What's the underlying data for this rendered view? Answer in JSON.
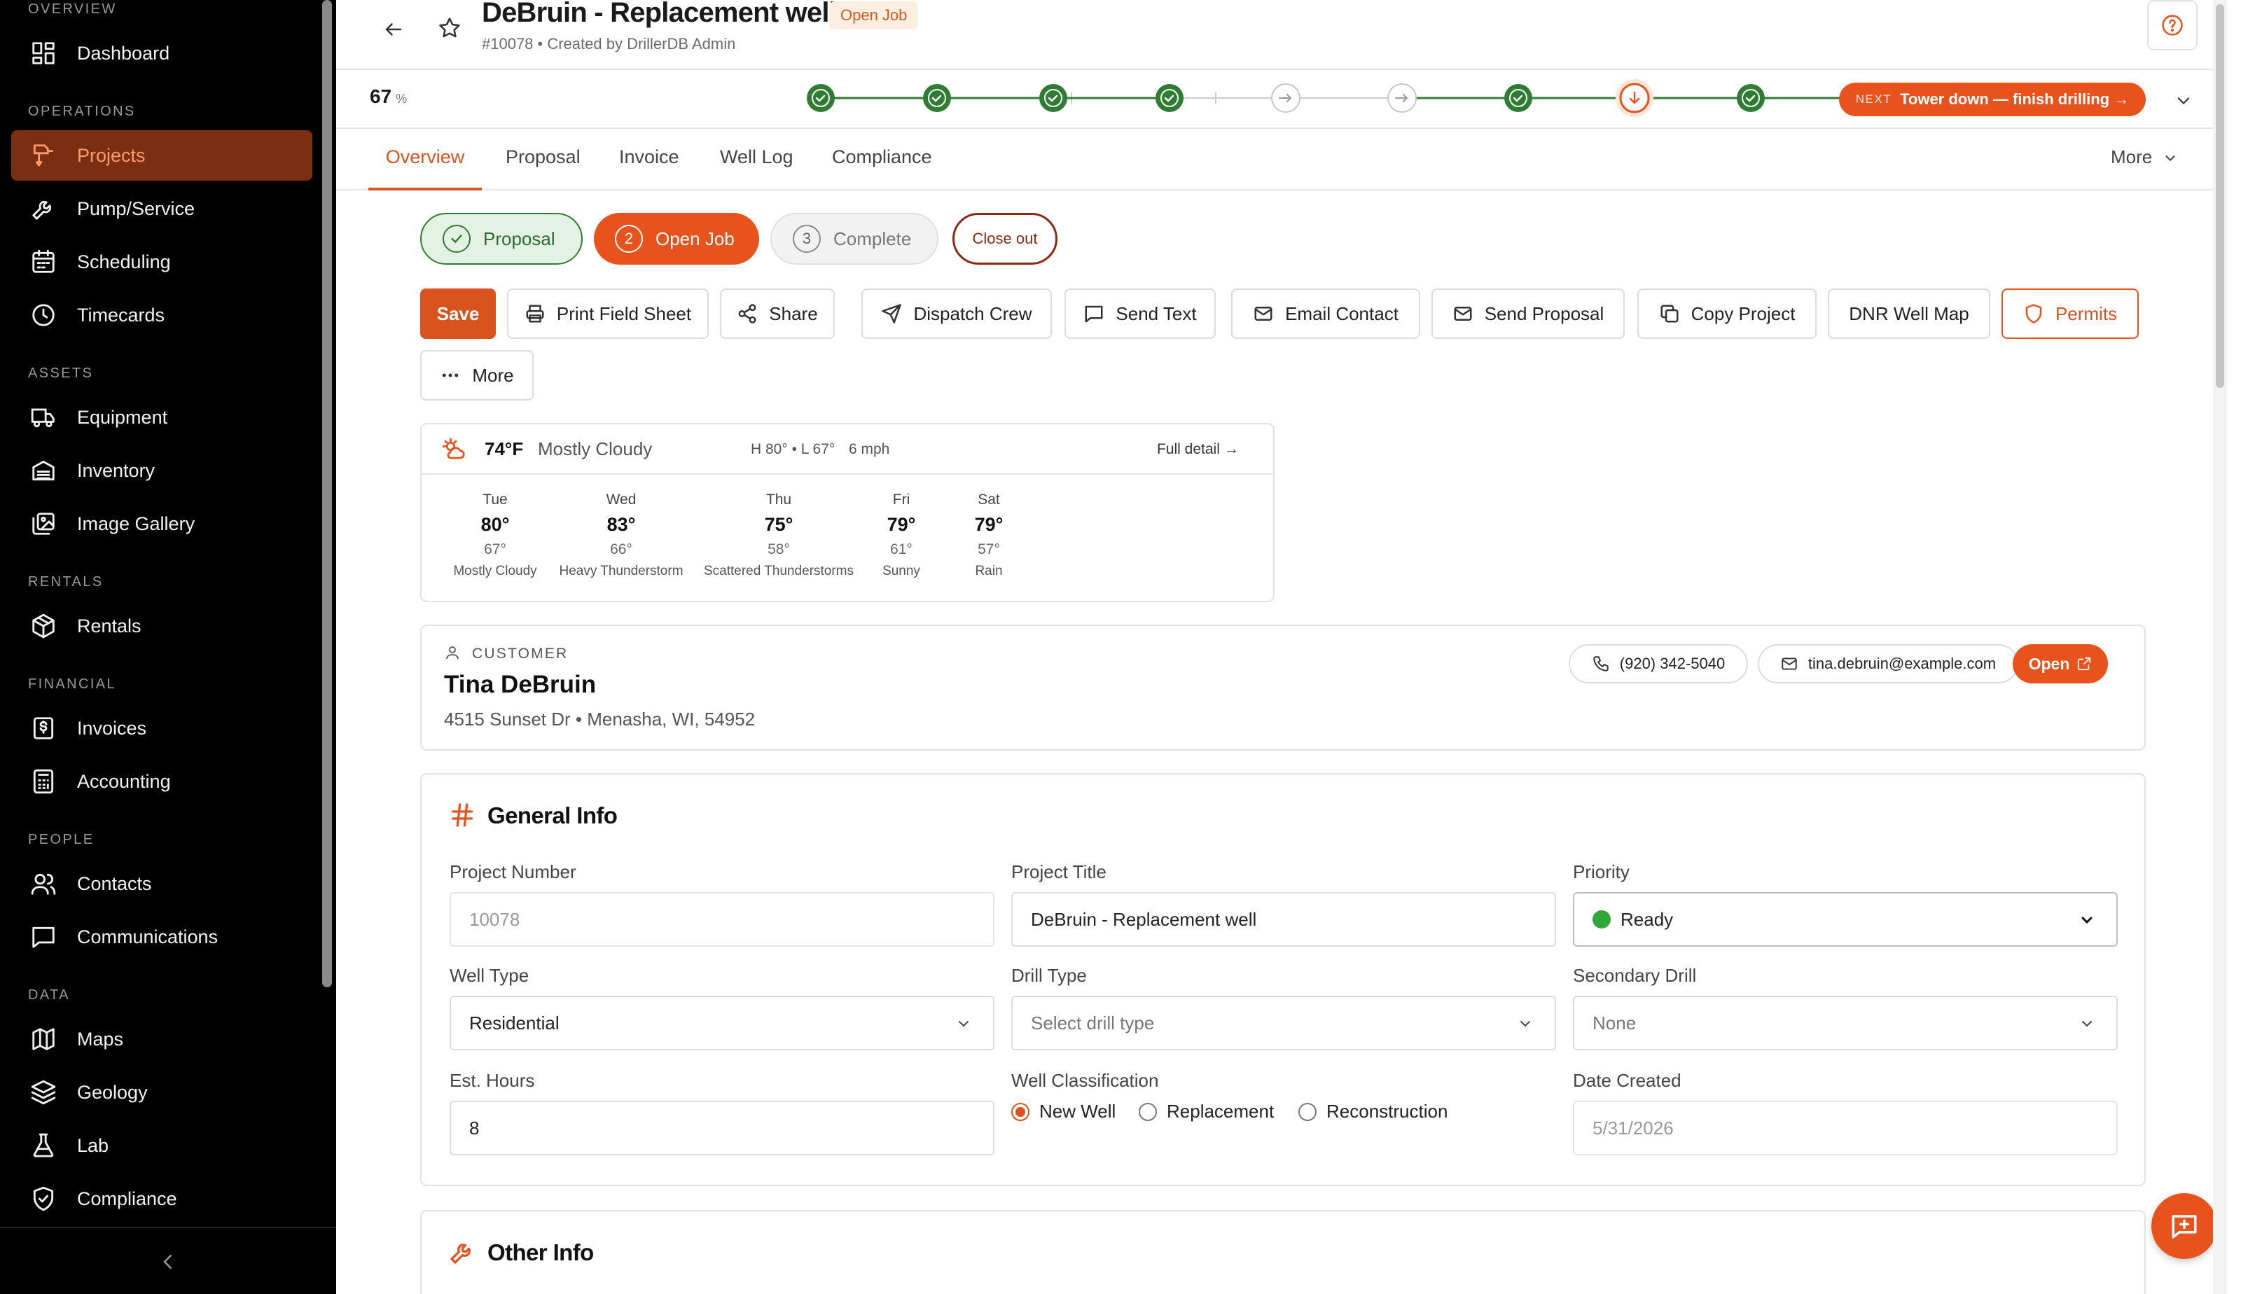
{
  "sidebar": {
    "sections": {
      "overview": "OVERVIEW",
      "operations": "OPERATIONS",
      "assets": "ASSETS",
      "rentals": "RENTALS",
      "financial": "FINANCIAL",
      "people": "PEOPLE",
      "data": "DATA"
    },
    "items": {
      "dashboard": "Dashboard",
      "projects": "Projects",
      "pump_service": "Pump/Service",
      "scheduling": "Scheduling",
      "timecards": "Timecards",
      "equipment": "Equipment",
      "inventory": "Inventory",
      "image_gallery": "Image Gallery",
      "rentals": "Rentals",
      "invoices": "Invoices",
      "accounting": "Accounting",
      "contacts": "Contacts",
      "communications": "Communications",
      "maps": "Maps",
      "geology": "Geology",
      "lab": "Lab",
      "compliance": "Compliance"
    },
    "active": "projects"
  },
  "header": {
    "title": "DeBruin - Replacement well",
    "badge": "Open Job",
    "subtitle": "#10078 • Created by DrillerDB Admin"
  },
  "progress": {
    "percent": "67",
    "percent_unit": "%",
    "next_label": "NEXT",
    "next_action": "Tower down — finish drilling →"
  },
  "tabs": {
    "overview": "Overview",
    "proposal": "Proposal",
    "invoice": "Invoice",
    "well_log": "Well Log",
    "compliance": "Compliance",
    "more": "More"
  },
  "status": {
    "proposal": "Proposal",
    "open_job_num": "2",
    "open_job": "Open Job",
    "complete_num": "3",
    "complete": "Complete",
    "close_out": "Close out"
  },
  "actions": {
    "save": "Save",
    "print_field_sheet": "Print Field Sheet",
    "share": "Share",
    "dispatch_crew": "Dispatch Crew",
    "send_text": "Send Text",
    "email_contact": "Email Contact",
    "send_proposal": "Send Proposal",
    "copy_project": "Copy Project",
    "dnr_well_map": "DNR Well Map",
    "permits": "Permits",
    "more": "More"
  },
  "weather": {
    "temp": "74°F",
    "condition": "Mostly Cloudy",
    "high_low": "H 80° • L 67°",
    "wind": "6 mph",
    "full_detail": "Full detail →",
    "forecast": [
      {
        "day": "Tue",
        "high": "80°",
        "low": "67°",
        "cond": "Mostly Cloudy"
      },
      {
        "day": "Wed",
        "high": "83°",
        "low": "66°",
        "cond": "Heavy Thunderstorm"
      },
      {
        "day": "Thu",
        "high": "75°",
        "low": "58°",
        "cond": "Scattered Thunderstorms"
      },
      {
        "day": "Fri",
        "high": "79°",
        "low": "61°",
        "cond": "Sunny"
      },
      {
        "day": "Sat",
        "high": "79°",
        "low": "57°",
        "cond": "Rain"
      }
    ]
  },
  "customer": {
    "label": "CUSTOMER",
    "name": "Tina DeBruin",
    "address": "4515 Sunset Dr • Menasha, WI, 54952",
    "phone": "(920) 342-5040",
    "email": "tina.debruin@example.com",
    "open": "Open"
  },
  "general_info": {
    "title": "General Info",
    "project_number_label": "Project Number",
    "project_number": "10078",
    "project_title_label": "Project Title",
    "project_title": "DeBruin - Replacement well",
    "priority_label": "Priority",
    "priority": "Ready",
    "well_type_label": "Well Type",
    "well_type": "Residential",
    "drill_type_label": "Drill Type",
    "drill_type_placeholder": "Select drill type",
    "secondary_drill_label": "Secondary Drill",
    "secondary_drill": "None",
    "est_hours_label": "Est. Hours",
    "est_hours": "8",
    "well_classification_label": "Well Classification",
    "classification_options": [
      "New Well",
      "Replacement",
      "Reconstruction"
    ],
    "classification_selected": "New Well",
    "date_created_label": "Date Created",
    "date_created": "5/31/2026"
  },
  "other_info": {
    "title": "Other Info"
  },
  "colors": {
    "accent": "#e8521d",
    "accent_text": "#d9531e",
    "success": "#2e7d32",
    "sidebar_bg": "#000000",
    "sidebar_active": "#7a2e12"
  }
}
